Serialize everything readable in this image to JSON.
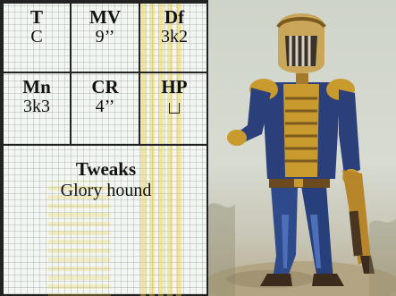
{
  "stats": [
    {
      "label": "T",
      "value": "C"
    },
    {
      "label": "MV",
      "value": "9’’"
    },
    {
      "label": "Df",
      "value": "3k2"
    },
    {
      "label": "Mn",
      "value": "3k3"
    },
    {
      "label": "CR",
      "value": "4’’"
    },
    {
      "label": "HP",
      "value_icon": "empty-box-icon"
    }
  ],
  "tweaks": {
    "title": "Tweaks",
    "text": "Glory hound"
  },
  "miniature": {
    "description_icon": "armored-figure-miniature"
  },
  "colors": {
    "panel_bg": "#f3f6f2",
    "grid": "#788c7d",
    "stripe": "#eece3c",
    "border": "#222222",
    "vest": "#2b3f7a",
    "gold": "#c99a2e"
  }
}
